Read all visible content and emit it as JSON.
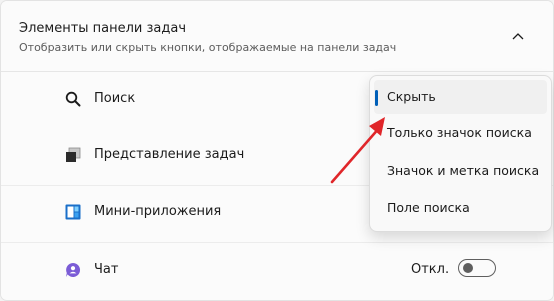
{
  "section": {
    "title": "Элементы панели задач",
    "subtitle": "Отобразить или скрыть кнопки, отображаемые на панели задач"
  },
  "rows": [
    {
      "label": "Поиск",
      "icon": "search-icon"
    },
    {
      "label": "Представление задач",
      "icon": "task-view-icon"
    },
    {
      "label": "Мини-приложения",
      "icon": "widgets-icon"
    },
    {
      "label": "Чат",
      "icon": "chat-icon",
      "toggle_state": "Откл.",
      "toggle_on": false
    }
  ],
  "dropdown": {
    "selected": "Скрыть",
    "options": [
      "Скрыть",
      "Только значок поиска",
      "Значок и метка поиска",
      "Поле поиска"
    ]
  },
  "colors": {
    "accent": "#005fb8",
    "arrow": "#e0262a",
    "chat": "#7b5cd6"
  }
}
